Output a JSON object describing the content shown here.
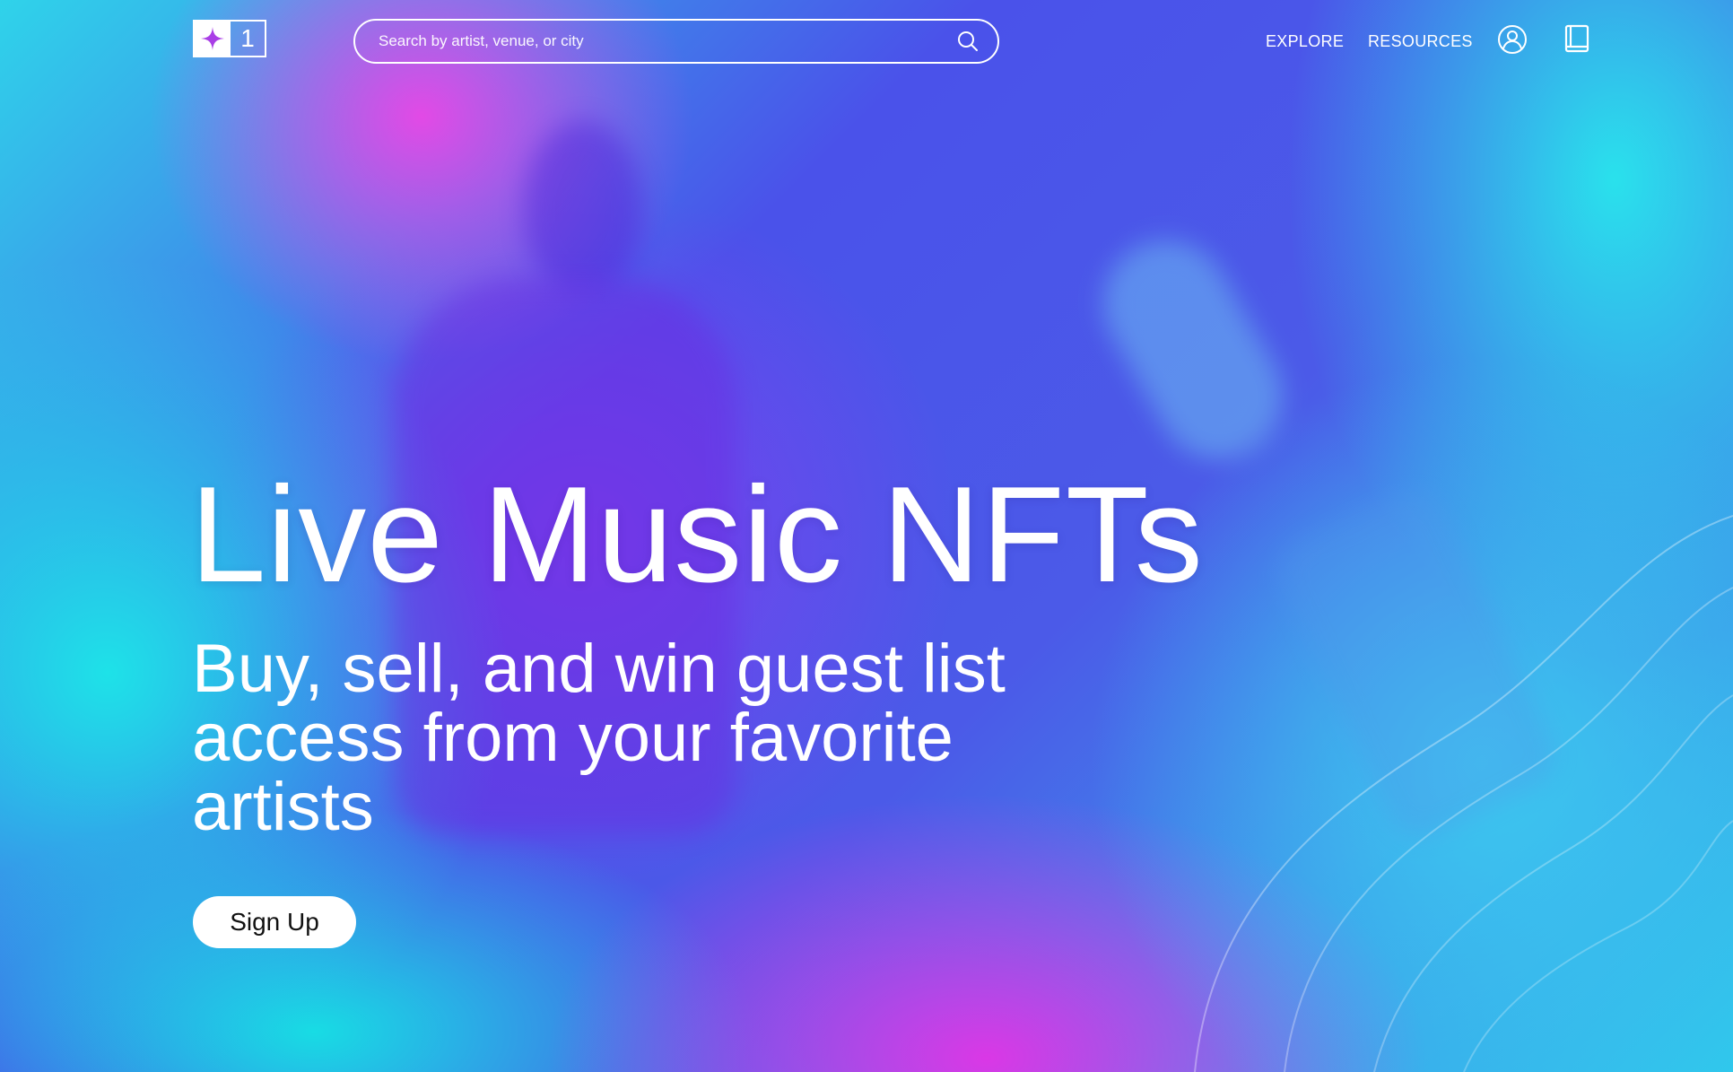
{
  "header": {
    "logo_text": "1",
    "search": {
      "placeholder": "Search by artist, venue, or city",
      "value": ""
    },
    "nav": {
      "explore": "EXPLORE",
      "resources": "RESOURCES"
    },
    "icons": [
      "star-icon",
      "search-icon",
      "user-icon",
      "book-icon"
    ]
  },
  "hero": {
    "title": "Live Music NFTs",
    "subtitle": "Buy, sell, and win guest list access from your favorite artists",
    "cta_label": "Sign Up"
  },
  "colors": {
    "cyan": "#1ee2e8",
    "blue": "#4a52ea",
    "magenta": "#e234e6",
    "text": "#ffffff",
    "button_bg": "#ffffff",
    "button_text": "#111111"
  }
}
